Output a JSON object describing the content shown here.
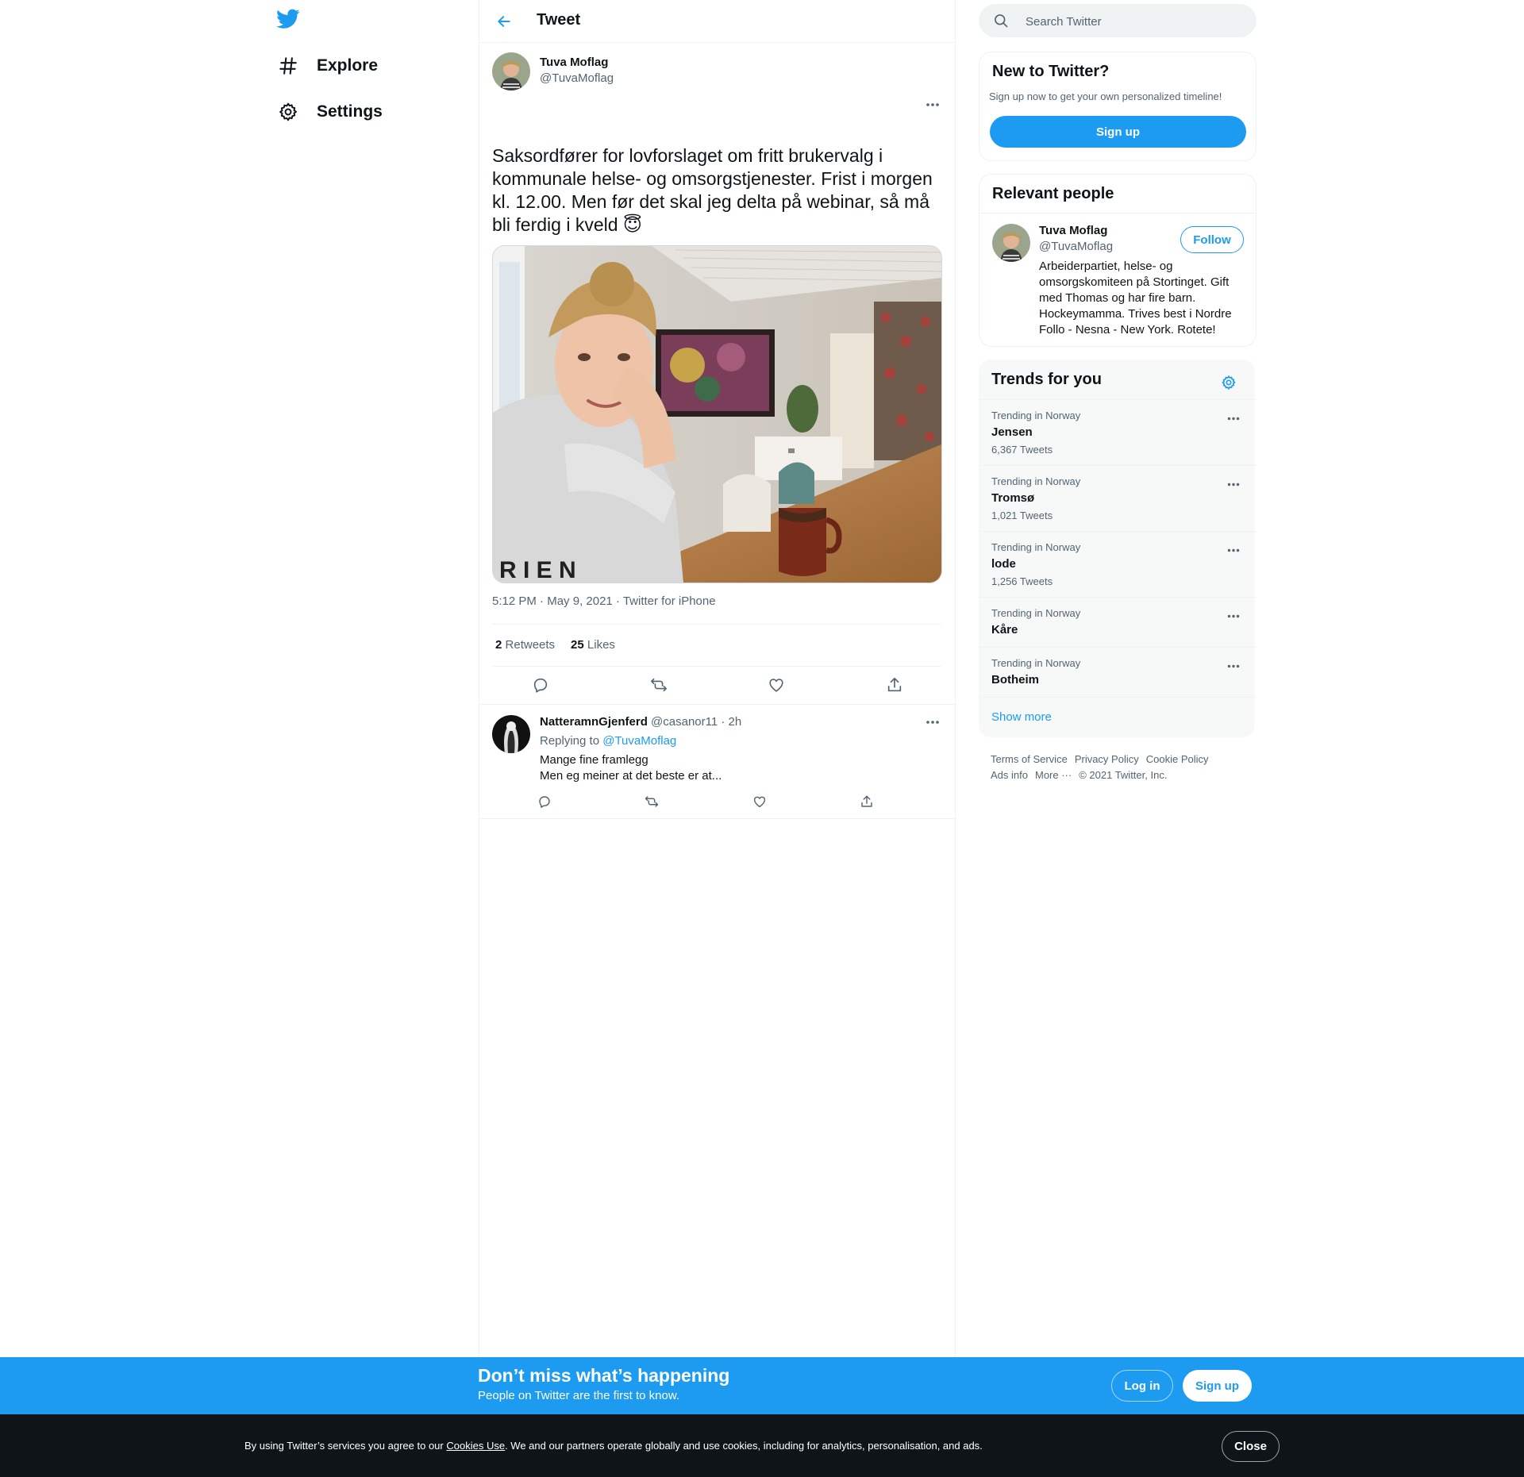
{
  "nav": {
    "logo_icon": "twitter-bird-icon",
    "items": [
      {
        "label": "Explore",
        "icon": "hashtag-icon"
      },
      {
        "label": "Settings",
        "icon": "gear-icon"
      }
    ]
  },
  "header": {
    "title": "Tweet",
    "back_icon": "back-arrow-icon"
  },
  "tweet": {
    "author_name": "Tuva Moflag",
    "author_handle": "@TuvaMoflag",
    "text": "Saksordfører for lovforslaget om fritt brukervalg i kommunale helse- og omsorgstjenester. Frist i morgen kl. 12.00. Men før det skal jeg delta på webinar, så må bli ferdig i kveld 😇",
    "time": "5:12 PM",
    "date": "May 9, 2021",
    "source": "Twitter for iPhone",
    "separator": " · ",
    "retweets_count": "2",
    "retweets_label": "Retweets",
    "likes_count": "25",
    "likes_label": "Likes"
  },
  "reply": {
    "name": "NatteramnGjenferd",
    "handle": "@casanor11",
    "time": "· 2h",
    "replying_prefix": "Replying to",
    "replying_to": "@TuvaMoflag",
    "line1": "Mange fine framlegg",
    "line2": "Men eg meiner at det beste er at..."
  },
  "search": {
    "placeholder": "Search Twitter"
  },
  "new_to_twitter": {
    "title": "New to Twitter?",
    "subtitle": "Sign up now to get your own personalized timeline!",
    "button": "Sign up"
  },
  "relevant_people": {
    "title": "Relevant people",
    "name": "Tuva Moflag",
    "handle": "@TuvaMoflag",
    "follow": "Follow",
    "bio": "Arbeiderpartiet, helse- og omsorgskomiteen på Stortinget. Gift med Thomas og har fire barn. Hockeymamma. Trives best i Nordre Follo - Nesna - New York. Rotete!"
  },
  "trends": {
    "title": "Trends for you",
    "items": [
      {
        "context": "Trending in Norway",
        "name": "Jensen",
        "count": "6,367 Tweets"
      },
      {
        "context": "Trending in Norway",
        "name": "Tromsø",
        "count": "1,021 Tweets"
      },
      {
        "context": "Trending in Norway",
        "name": "lode",
        "count": "1,256 Tweets"
      },
      {
        "context": "Trending in Norway",
        "name": "Kåre",
        "count": ""
      },
      {
        "context": "Trending in Norway",
        "name": "Botheim",
        "count": ""
      }
    ],
    "show_more": "Show more"
  },
  "footer": {
    "links": [
      "Terms of Service",
      "Privacy Policy",
      "Cookie Policy",
      "Ads info",
      "More ···"
    ],
    "copyright": "© 2021 Twitter, Inc."
  },
  "banner": {
    "title": "Don’t miss what’s happening",
    "subtitle": "People on Twitter are the first to know.",
    "login": "Log in",
    "signup": "Sign up"
  },
  "cookie": {
    "text_before": "By using Twitter’s services you agree to our ",
    "link": "Cookies Use",
    "text_after": ". We and our partners operate globally and use cookies, including for analytics, personalisation, and ads.",
    "close": "Close"
  },
  "colors": {
    "accent": "#1d9bf0",
    "text": "#0f1419",
    "muted": "#536471",
    "cookie_bg": "#0f1419"
  }
}
